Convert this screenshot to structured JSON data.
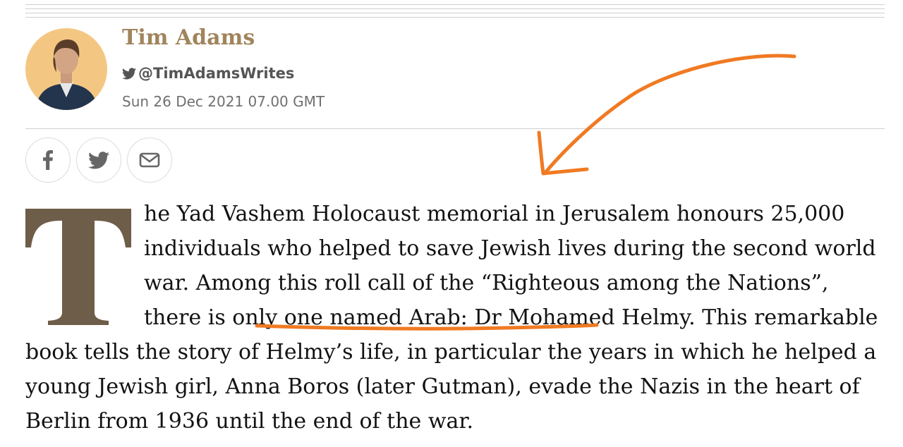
{
  "author": {
    "name": "Tim Adams",
    "twitter_handle": "@TimAdamsWrites",
    "date": "Sun 26 Dec 2021 07.00 GMT"
  },
  "share": {
    "icons": [
      "facebook-icon",
      "twitter-icon",
      "email-icon"
    ]
  },
  "article": {
    "drop_cap": "T",
    "text_start": "he Yad Vashem Holocaust memorial in Jerusalem honours 25,000 individuals who helped to save Jewish lives during the second world war. Among this roll call of the “Righteous among the Nations”, ",
    "highlight": "there is only one named Arab:",
    "text_end": " Dr Mohamed Helmy. This remarkable book tells the story of Helmy’s life, in particular the years in which he helped a young Jewish girl, Anna Boros (later Gutman), evade the Nazis in the heart of Berlin from 1936 until the end of the war."
  },
  "colors": {
    "byline": "#a1845c",
    "drop_cap": "#6e5d48",
    "annotation": "#f07a22",
    "avatar_bg": "#f3c782"
  }
}
